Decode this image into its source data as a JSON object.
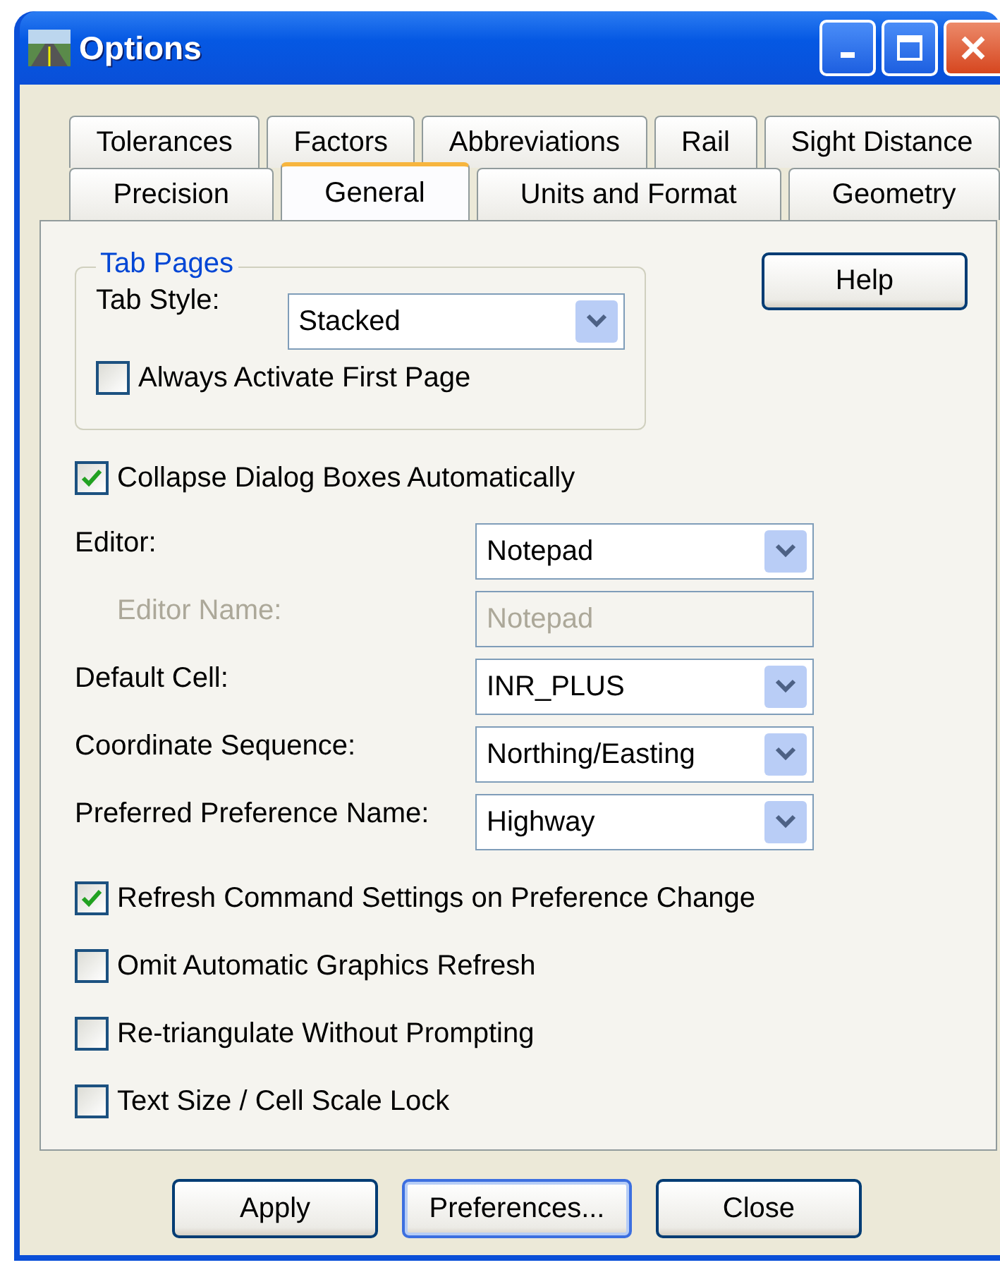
{
  "window": {
    "title": "Options"
  },
  "tab_rows": [
    [
      {
        "label": "Tolerances",
        "selected": false
      },
      {
        "label": "Factors",
        "selected": false
      },
      {
        "label": "Abbreviations",
        "selected": false
      },
      {
        "label": "Rail",
        "selected": false
      },
      {
        "label": "Sight Distance",
        "selected": false
      }
    ],
    [
      {
        "label": "Precision",
        "selected": false
      },
      {
        "label": "General",
        "selected": true
      },
      {
        "label": "Units and Format",
        "selected": false
      },
      {
        "label": "Geometry",
        "selected": false
      }
    ]
  ],
  "tab_pages": {
    "title": "Tab Pages",
    "tab_style_label": "Tab Style:",
    "tab_style_value": "Stacked",
    "always_activate": {
      "label": "Always Activate First Page",
      "checked": false
    }
  },
  "help_button": "Help",
  "collapse": {
    "label": "Collapse Dialog Boxes Automatically",
    "checked": true
  },
  "fields": [
    {
      "kind": "dropdown",
      "label": "Editor:",
      "value": "Notepad",
      "disabled": false,
      "indented": false
    },
    {
      "kind": "textbox",
      "label": "Editor Name:",
      "value": "Notepad",
      "disabled": true,
      "indented": true
    },
    {
      "kind": "dropdown",
      "label": "Default Cell:",
      "value": "INR_PLUS",
      "disabled": false,
      "indented": false
    },
    {
      "kind": "dropdown",
      "label": "Coordinate Sequence:",
      "value": "Northing/Easting",
      "disabled": false,
      "indented": false
    },
    {
      "kind": "dropdown",
      "label": "Preferred Preference Name:",
      "value": "Highway",
      "disabled": false,
      "indented": false
    }
  ],
  "checkboxes": [
    {
      "label": "Refresh Command Settings on Preference Change",
      "checked": true
    },
    {
      "label": "Omit Automatic Graphics Refresh",
      "checked": false
    },
    {
      "label": "Re-triangulate Without Prompting",
      "checked": false
    },
    {
      "label": "Text Size / Cell Scale Lock",
      "checked": false
    }
  ],
  "buttons": [
    {
      "label": "Apply",
      "default": false
    },
    {
      "label": "Preferences...",
      "default": true
    },
    {
      "label": "Close",
      "default": false
    }
  ]
}
